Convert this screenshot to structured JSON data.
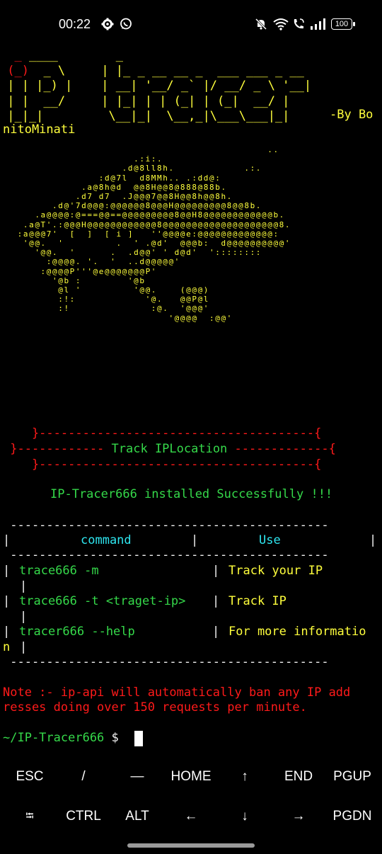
{
  "status_bar": {
    "time": "00:22",
    "battery": "100",
    "left_icons": [
      "gear-icon",
      "whatsapp-icon"
    ],
    "right_icons": [
      "bell-muted-icon",
      "wifi-icon",
      "wifi-call-icon",
      "signal-icon",
      "battery-icon"
    ]
  },
  "banner": {
    "ascii_logo": "  _ ____        _\n (_)  _ \\     | |_ _ __ __ _  ___ ___ _ __\n | | |_) |    | __| '__/ _` |/ __/ _ \\ '__|\n | |  __/     | |_| | | (_| | (_|  __/ |\n |_|_|         \\__|_|  \\__,_|\\___\\___|_|",
    "byline": "-By Bo",
    "byline_wrap": "nitoMinati"
  },
  "eye_art": "                                              ..\n                       .:i:.\n                     .d@8ll8h.            .:.\n                 :d@7l  d8MMh.. .:dd@:\n              .a@8h@d  @@8H@@8@888@88b.\n             .d7 d7  .J@@@7@@8H@@8h@@8h.\n         .d@'7d@@@:@@@@@@8@@@H@@@@@@@@@8@@8b.\n      .a@@@@:@===@@==@@@@@@@@@8@@H8@@@@@@@@@@@@b.\n    .a@T'.:@@@H@@@@@@@@@@@@8@@@@@@@@@@@@@@@@@@@@8.\n   :a@@@7'  [  ]  [ i ]   ''@@@@e:@@@@@@@@@@@@@:\n    '@@.  '         .  ' .@d'  @@@b:  d@@@@@@@@@@'\n      '@@.  '      .  .d@@' ' d@d'  '::::::::\n        :@@@@. '.  '  ..d@@@@@'\n       :@@@@P'''@e@@@@@@@P'\n         '@b :        '@b\n          @l '         '@@.    (@@@)\n          :!:            '@.   @@P@l\n          :!              :@.  '@@@'\n                             '@@@@  :@@'",
  "menu_box": {
    "top": "    }--------------------------------------{",
    "middle_left": " }------------ ",
    "middle_label": "Track IPLocation",
    "middle_right": " -------------{",
    "bottom": "    }--------------------------------------{"
  },
  "install_message": "IP-Tracer666 installed Successfully !!!",
  "command_table": {
    "rule": " --------------------------------------------",
    "headers": [
      "command",
      "Use"
    ],
    "rows": [
      {
        "command": "trace666 -m",
        "use": "Track your IP",
        "wrap": ""
      },
      {
        "command": "trace666 -t <traget-ip>",
        "use": "Track IP",
        "wrap": ""
      },
      {
        "command": "tracer666 --help",
        "use": "For more informatio",
        "wrap": "n"
      }
    ]
  },
  "note": {
    "line1": "Note :- ip-api will automatically ban any IP add",
    "line2": "resses doing over 150 requests per minute."
  },
  "prompt": {
    "path": "~/IP-Tracer666",
    "symbol": "$"
  },
  "extra_keys": {
    "row1": [
      "ESC",
      "/",
      "—",
      "HOME",
      "↑",
      "END",
      "PGUP"
    ],
    "row2": [
      "⭾",
      "CTRL",
      "ALT",
      "←",
      "↓",
      "→",
      "PGDN"
    ]
  }
}
